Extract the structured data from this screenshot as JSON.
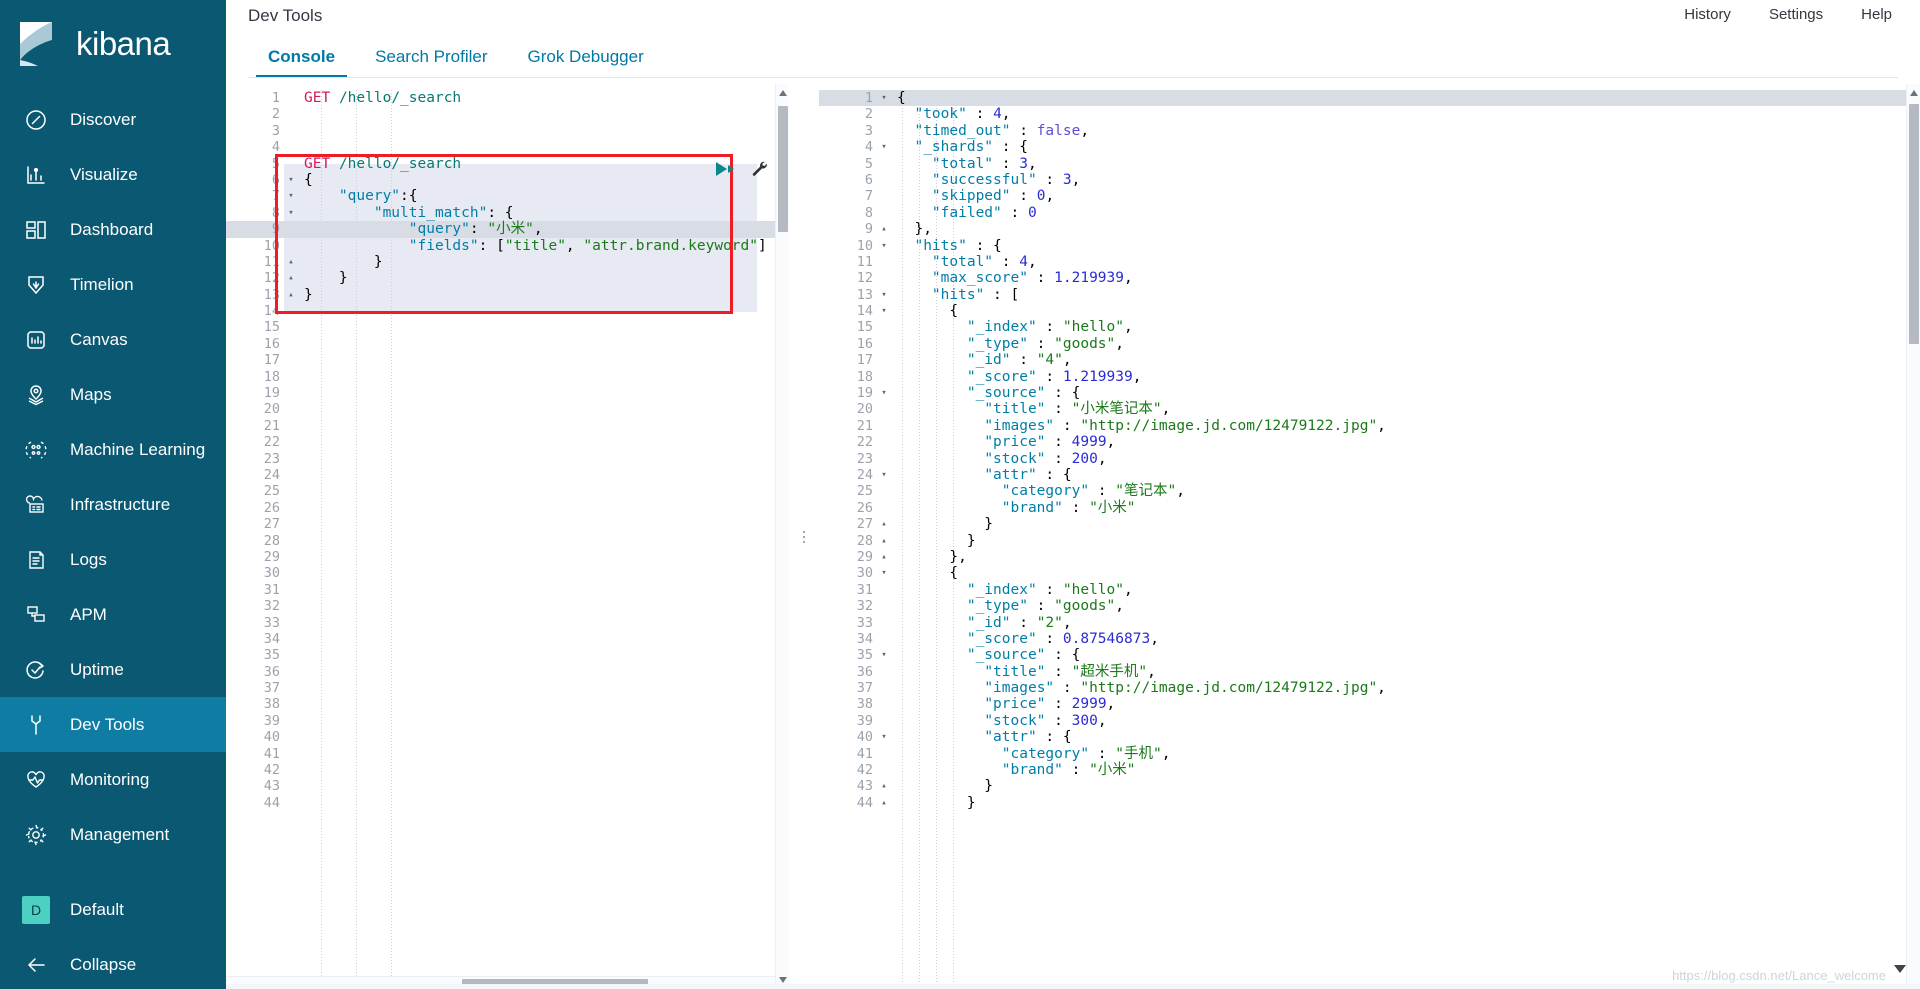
{
  "brand": {
    "name": "kibana",
    "logo_icon": "kibana-logo-icon"
  },
  "sidebar": {
    "items": [
      {
        "label": "Discover",
        "icon": "compass-icon",
        "active": false
      },
      {
        "label": "Visualize",
        "icon": "bar-chart-icon",
        "active": false
      },
      {
        "label": "Dashboard",
        "icon": "dashboard-grid-icon",
        "active": false
      },
      {
        "label": "Timelion",
        "icon": "timelion-shield-icon",
        "active": false
      },
      {
        "label": "Canvas",
        "icon": "canvas-icon",
        "active": false
      },
      {
        "label": "Maps",
        "icon": "map-marker-icon",
        "active": false
      },
      {
        "label": "Machine Learning",
        "icon": "machine-learning-icon",
        "active": false
      },
      {
        "label": "Infrastructure",
        "icon": "infrastructure-icon",
        "active": false
      },
      {
        "label": "Logs",
        "icon": "logs-document-icon",
        "active": false
      },
      {
        "label": "APM",
        "icon": "apm-icon",
        "active": false
      },
      {
        "label": "Uptime",
        "icon": "uptime-check-icon",
        "active": false
      },
      {
        "label": "Dev Tools",
        "icon": "wrench-icon",
        "active": true
      },
      {
        "label": "Monitoring",
        "icon": "heartbeat-icon",
        "active": false
      },
      {
        "label": "Management",
        "icon": "gear-icon",
        "active": false
      }
    ],
    "space": {
      "label": "Default",
      "badge": "D",
      "badge_color": "#4dd0c1"
    },
    "collapse": {
      "label": "Collapse",
      "icon": "arrow-left-icon"
    }
  },
  "header": {
    "app_title": "Dev Tools",
    "actions": [
      {
        "label": "History"
      },
      {
        "label": "Settings"
      },
      {
        "label": "Help"
      }
    ]
  },
  "tabs": [
    {
      "label": "Console",
      "active": true
    },
    {
      "label": "Search Profiler",
      "active": false
    },
    {
      "label": "Grok Debugger",
      "active": false
    }
  ],
  "console": {
    "run_button_icon": "play-icon",
    "wrench_button_icon": "wrench-icon",
    "accent_color": "#0079a5",
    "run_color": "#0b8787",
    "highlight_box_color": "#ee1c25",
    "request_lines": [
      {
        "n": 1,
        "fold": "",
        "text": "GET /hello/_search",
        "type": "request"
      },
      {
        "n": 2,
        "fold": "",
        "text": ""
      },
      {
        "n": 3,
        "fold": "",
        "text": ""
      },
      {
        "n": 4,
        "fold": "",
        "text": ""
      },
      {
        "n": 5,
        "fold": "",
        "text": "GET /hello/_search",
        "type": "request"
      },
      {
        "n": 6,
        "fold": "▾",
        "text": "{"
      },
      {
        "n": 7,
        "fold": "▾",
        "text": "    \"query\":{"
      },
      {
        "n": 8,
        "fold": "▾",
        "text": "        \"multi_match\": {"
      },
      {
        "n": 9,
        "fold": "",
        "text": "            \"query\": \"小米\","
      },
      {
        "n": 10,
        "fold": "",
        "text": "            \"fields\": [\"title\", \"attr.brand.keyword\"]"
      },
      {
        "n": 11,
        "fold": "▴",
        "text": "        }"
      },
      {
        "n": 12,
        "fold": "▴",
        "text": "    }"
      },
      {
        "n": 13,
        "fold": "▴",
        "text": "}"
      },
      {
        "n": 14,
        "fold": "",
        "text": ""
      },
      {
        "n": 15,
        "fold": "",
        "text": ""
      },
      {
        "n": 16,
        "fold": "",
        "text": ""
      },
      {
        "n": 17,
        "fold": "",
        "text": ""
      },
      {
        "n": 18,
        "fold": "",
        "text": ""
      },
      {
        "n": 19,
        "fold": "",
        "text": ""
      },
      {
        "n": 20,
        "fold": "",
        "text": ""
      },
      {
        "n": 21,
        "fold": "",
        "text": ""
      },
      {
        "n": 22,
        "fold": "",
        "text": ""
      },
      {
        "n": 23,
        "fold": "",
        "text": ""
      },
      {
        "n": 24,
        "fold": "",
        "text": ""
      },
      {
        "n": 25,
        "fold": "",
        "text": ""
      },
      {
        "n": 26,
        "fold": "",
        "text": ""
      },
      {
        "n": 27,
        "fold": "",
        "text": ""
      },
      {
        "n": 28,
        "fold": "",
        "text": ""
      },
      {
        "n": 29,
        "fold": "",
        "text": ""
      },
      {
        "n": 30,
        "fold": "",
        "text": ""
      },
      {
        "n": 31,
        "fold": "",
        "text": ""
      },
      {
        "n": 32,
        "fold": "",
        "text": ""
      },
      {
        "n": 33,
        "fold": "",
        "text": ""
      },
      {
        "n": 34,
        "fold": "",
        "text": ""
      },
      {
        "n": 35,
        "fold": "",
        "text": ""
      },
      {
        "n": 36,
        "fold": "",
        "text": ""
      },
      {
        "n": 37,
        "fold": "",
        "text": ""
      },
      {
        "n": 38,
        "fold": "",
        "text": ""
      },
      {
        "n": 39,
        "fold": "",
        "text": ""
      },
      {
        "n": 40,
        "fold": "",
        "text": ""
      },
      {
        "n": 41,
        "fold": "",
        "text": ""
      },
      {
        "n": 42,
        "fold": "",
        "text": ""
      },
      {
        "n": 43,
        "fold": "",
        "text": ""
      },
      {
        "n": 44,
        "fold": "",
        "text": ""
      }
    ],
    "response_lines": [
      {
        "n": 1,
        "fold": "▾",
        "text": "{"
      },
      {
        "n": 2,
        "fold": "",
        "text": "  \"took\" : 4,"
      },
      {
        "n": 3,
        "fold": "",
        "text": "  \"timed_out\" : false,"
      },
      {
        "n": 4,
        "fold": "▾",
        "text": "  \"_shards\" : {"
      },
      {
        "n": 5,
        "fold": "",
        "text": "    \"total\" : 3,"
      },
      {
        "n": 6,
        "fold": "",
        "text": "    \"successful\" : 3,"
      },
      {
        "n": 7,
        "fold": "",
        "text": "    \"skipped\" : 0,"
      },
      {
        "n": 8,
        "fold": "",
        "text": "    \"failed\" : 0"
      },
      {
        "n": 9,
        "fold": "▴",
        "text": "  },"
      },
      {
        "n": 10,
        "fold": "▾",
        "text": "  \"hits\" : {"
      },
      {
        "n": 11,
        "fold": "",
        "text": "    \"total\" : 4,"
      },
      {
        "n": 12,
        "fold": "",
        "text": "    \"max_score\" : 1.219939,"
      },
      {
        "n": 13,
        "fold": "▾",
        "text": "    \"hits\" : ["
      },
      {
        "n": 14,
        "fold": "▾",
        "text": "      {"
      },
      {
        "n": 15,
        "fold": "",
        "text": "        \"_index\" : \"hello\","
      },
      {
        "n": 16,
        "fold": "",
        "text": "        \"_type\" : \"goods\","
      },
      {
        "n": 17,
        "fold": "",
        "text": "        \"_id\" : \"4\","
      },
      {
        "n": 18,
        "fold": "",
        "text": "        \"_score\" : 1.219939,"
      },
      {
        "n": 19,
        "fold": "▾",
        "text": "        \"_source\" : {"
      },
      {
        "n": 20,
        "fold": "",
        "text": "          \"title\" : \"小米笔记本\","
      },
      {
        "n": 21,
        "fold": "",
        "text": "          \"images\" : \"http://image.jd.com/12479122.jpg\","
      },
      {
        "n": 22,
        "fold": "",
        "text": "          \"price\" : 4999,"
      },
      {
        "n": 23,
        "fold": "",
        "text": "          \"stock\" : 200,"
      },
      {
        "n": 24,
        "fold": "▾",
        "text": "          \"attr\" : {"
      },
      {
        "n": 25,
        "fold": "",
        "text": "            \"category\" : \"笔记本\","
      },
      {
        "n": 26,
        "fold": "",
        "text": "            \"brand\" : \"小米\""
      },
      {
        "n": 27,
        "fold": "▴",
        "text": "          }"
      },
      {
        "n": 28,
        "fold": "▴",
        "text": "        }"
      },
      {
        "n": 29,
        "fold": "▴",
        "text": "      },"
      },
      {
        "n": 30,
        "fold": "▾",
        "text": "      {"
      },
      {
        "n": 31,
        "fold": "",
        "text": "        \"_index\" : \"hello\","
      },
      {
        "n": 32,
        "fold": "",
        "text": "        \"_type\" : \"goods\","
      },
      {
        "n": 33,
        "fold": "",
        "text": "        \"_id\" : \"2\","
      },
      {
        "n": 34,
        "fold": "",
        "text": "        \"_score\" : 0.87546873,"
      },
      {
        "n": 35,
        "fold": "▾",
        "text": "        \"_source\" : {"
      },
      {
        "n": 36,
        "fold": "",
        "text": "          \"title\" : \"超米手机\","
      },
      {
        "n": 37,
        "fold": "",
        "text": "          \"images\" : \"http://image.jd.com/12479122.jpg\","
      },
      {
        "n": 38,
        "fold": "",
        "text": "          \"price\" : 2999,"
      },
      {
        "n": 39,
        "fold": "",
        "text": "          \"stock\" : 300,"
      },
      {
        "n": 40,
        "fold": "▾",
        "text": "          \"attr\" : {"
      },
      {
        "n": 41,
        "fold": "",
        "text": "            \"category\" : \"手机\","
      },
      {
        "n": 42,
        "fold": "",
        "text": "            \"brand\" : \"小米\""
      },
      {
        "n": 43,
        "fold": "▴",
        "text": "          }"
      },
      {
        "n": 44,
        "fold": "▴",
        "text": "        }"
      }
    ]
  },
  "watermark": {
    "text": "https://blog.csdn.net/Lance_welcome"
  }
}
